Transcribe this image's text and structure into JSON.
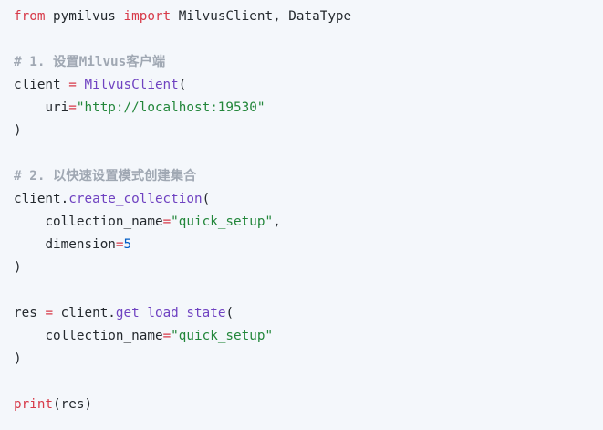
{
  "code": {
    "line1": {
      "kw_from": "from",
      "module": " pymilvus ",
      "kw_import": "import",
      "names": " MilvusClient, DataType"
    },
    "line3": {
      "comment": "# 1. 设置Milvus客户端"
    },
    "line4": {
      "var": "client ",
      "op": "=",
      "space": " ",
      "func": "MilvusClient",
      "paren": "("
    },
    "line5": {
      "indent": "    ",
      "param": "uri",
      "op": "=",
      "string": "\"http://localhost:19530\""
    },
    "line6": {
      "paren": ")"
    },
    "line8": {
      "comment": "# 2. 以快速设置模式创建集合"
    },
    "line9": {
      "obj": "client.",
      "method": "create_collection",
      "paren": "("
    },
    "line10": {
      "indent": "    ",
      "param": "collection_name",
      "op": "=",
      "string": "\"quick_setup\"",
      "comma": ","
    },
    "line11": {
      "indent": "    ",
      "param": "dimension",
      "op": "=",
      "number": "5"
    },
    "line12": {
      "paren": ")"
    },
    "line14": {
      "var": "res ",
      "op": "=",
      "obj": " client.",
      "method": "get_load_state",
      "paren": "("
    },
    "line15": {
      "indent": "    ",
      "param": "collection_name",
      "op": "=",
      "string": "\"quick_setup\""
    },
    "line16": {
      "paren": ")"
    },
    "line18": {
      "builtin": "print",
      "args": "(res)"
    }
  },
  "colors": {
    "background": "#f4f7fb",
    "keyword": "#d73a49",
    "function": "#6f42c1",
    "string": "#22863a",
    "number": "#005cc5",
    "comment": "#a0a8b3",
    "text": "#24292e"
  }
}
